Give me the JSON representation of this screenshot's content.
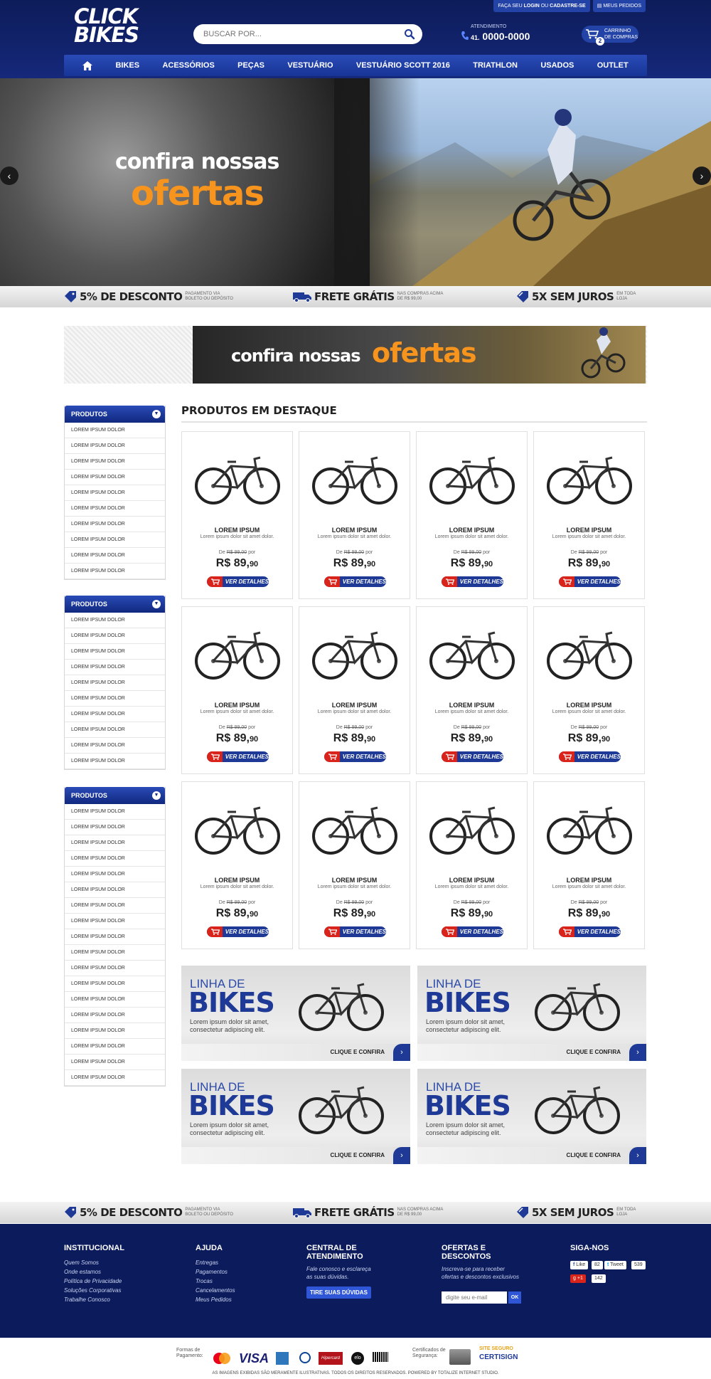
{
  "header": {
    "logo_line1": "CLICK",
    "logo_line2": "BIKES",
    "search_placeholder": "BUSCAR POR...",
    "top_links": {
      "login_prefix": "FAÇA SEU",
      "login": "LOGIN",
      "login_or": "OU",
      "signup": "CADASTRE-SE",
      "orders": "MEUS PEDIDOS"
    },
    "atendimento_label": "ATENDIMENTO",
    "phone_area": "41.",
    "phone_number": "0000-0000",
    "cart_label_1": "CARRINHO",
    "cart_label_2": "DE COMPRAS",
    "cart_count": "2"
  },
  "nav": {
    "items": [
      "BIKES",
      "ACESSÓRIOS",
      "PEÇAS",
      "VESTUÁRIO",
      "VESTUÁRIO SCOTT 2016",
      "TRIATHLON",
      "USADOS",
      "OUTLET"
    ]
  },
  "hero": {
    "line1": "confira nossas",
    "line2": "ofertas"
  },
  "benefits": {
    "discount": "5% DE DESCONTO",
    "discount_note": "PAGAMENTO VIA BOLETO OU DEPÓSITO",
    "shipping": "FRETE GRÁTIS",
    "shipping_note": "NAS COMPRAS ACIMA DE R$ 99,00",
    "installments": "5X SEM JUROS",
    "installments_note": "EM TODA LOJA"
  },
  "promo": {
    "line1": "confira nossas",
    "line2": "ofertas"
  },
  "sidebar": {
    "boxes": [
      {
        "title": "PRODUTOS",
        "items": [
          "LOREM IPSUM DOLOR",
          "LOREM IPSUM DOLOR",
          "LOREM IPSUM DOLOR",
          "LOREM IPSUM DOLOR",
          "LOREM IPSUM DOLOR",
          "LOREM IPSUM DOLOR",
          "LOREM IPSUM DOLOR",
          "LOREM IPSUM DOLOR",
          "LOREM IPSUM DOLOR",
          "LOREM IPSUM DOLOR"
        ]
      },
      {
        "title": "PRODUTOS",
        "items": [
          "LOREM IPSUM DOLOR",
          "LOREM IPSUM DOLOR",
          "LOREM IPSUM DOLOR",
          "LOREM IPSUM DOLOR",
          "LOREM IPSUM DOLOR",
          "LOREM IPSUM DOLOR",
          "LOREM IPSUM DOLOR",
          "LOREM IPSUM DOLOR",
          "LOREM IPSUM DOLOR",
          "LOREM IPSUM DOLOR"
        ]
      },
      {
        "title": "PRODUTOS",
        "items": [
          "LOREM IPSUM DOLOR",
          "LOREM IPSUM DOLOR",
          "LOREM IPSUM DOLOR",
          "LOREM IPSUM DOLOR",
          "LOREM IPSUM DOLOR",
          "LOREM IPSUM DOLOR",
          "LOREM IPSUM DOLOR",
          "LOREM IPSUM DOLOR",
          "LOREM IPSUM DOLOR",
          "LOREM IPSUM DOLOR",
          "LOREM IPSUM DOLOR",
          "LOREM IPSUM DOLOR",
          "LOREM IPSUM DOLOR",
          "LOREM IPSUM DOLOR",
          "LOREM IPSUM DOLOR",
          "LOREM IPSUM DOLOR",
          "LOREM IPSUM DOLOR",
          "LOREM IPSUM DOLOR"
        ]
      }
    ]
  },
  "products": {
    "section_title": "PRODUTOS EM DESTAQUE",
    "card": {
      "name": "LOREM IPSUM",
      "description": "Lorem ipsum dolor sit amet dolor.",
      "old_price_prefix": "De",
      "old_price": "R$ 99,00",
      "old_price_suffix": "por",
      "price_main": "R$ 89,",
      "price_cents": "90",
      "button": "VER DETALHES"
    },
    "count": 12
  },
  "banners": {
    "line1": "LINHA DE",
    "line2": "BIKES",
    "text": "Lorem ipsum dolor sit amet, consectetur adipiscing elit.",
    "cta": "CLIQUE E CONFIRA",
    "count": 4
  },
  "footer": {
    "institucional": {
      "title": "INSTITUCIONAL",
      "links": [
        "Quem Somos",
        "Onde estamos",
        "Política de Privacidade",
        "Soluções Corporativas",
        "Trabalhe Conosco"
      ]
    },
    "ajuda": {
      "title": "AJUDA",
      "links": [
        "Entregas",
        "Pagamentos",
        "Trocas",
        "Cancelamentos",
        "Meus Pedidos"
      ]
    },
    "central": {
      "title_1": "CENTRAL DE",
      "title_2": "ATENDIMENTO",
      "text_1": "Fale conosco e esclareça",
      "text_2": "as suas dúvidas.",
      "button": "TIRE SUAS DÚVIDAS"
    },
    "ofertas": {
      "title_1": "OFERTAS E",
      "title_2": "DESCONTOS",
      "text_1": "Inscreva-se para receber",
      "text_2": "ofertas e descontos exclusivos",
      "placeholder": "digite seu e-mail",
      "button": "OK"
    },
    "siga": {
      "title": "SIGA-NOS",
      "like": "Like",
      "like_count": "82",
      "tweet": "Tweet",
      "tweet_count": "539",
      "plus": "+1",
      "plus_count": "142"
    }
  },
  "bottom": {
    "payment_label_1": "Formas de",
    "payment_label_2": "Pagamento:",
    "payment_methods": [
      "mastercard",
      "VISA",
      "amex",
      "diners",
      "Hipercard",
      "elo",
      "Boleto"
    ],
    "security_label_1": "Certificados de",
    "security_label_2": "Segurança:",
    "site_seguro": "SITE SEGURO",
    "certisign": "CERTISIGN",
    "copyright": "AS IMAGENS EXIBIDAS SÃO MERAMENTE ILUSTRATIVAS. TODOS OS DIREITOS RESERVADOS. POWERED BY TOTALIZE INTERNET STUDIO."
  },
  "colors": {
    "header_navy": "#15287a",
    "nav_blue": "#2a4bb7",
    "orange": "#f7941d",
    "cart_red": "#d9241b",
    "footer_navy": "#0c1b5c"
  }
}
